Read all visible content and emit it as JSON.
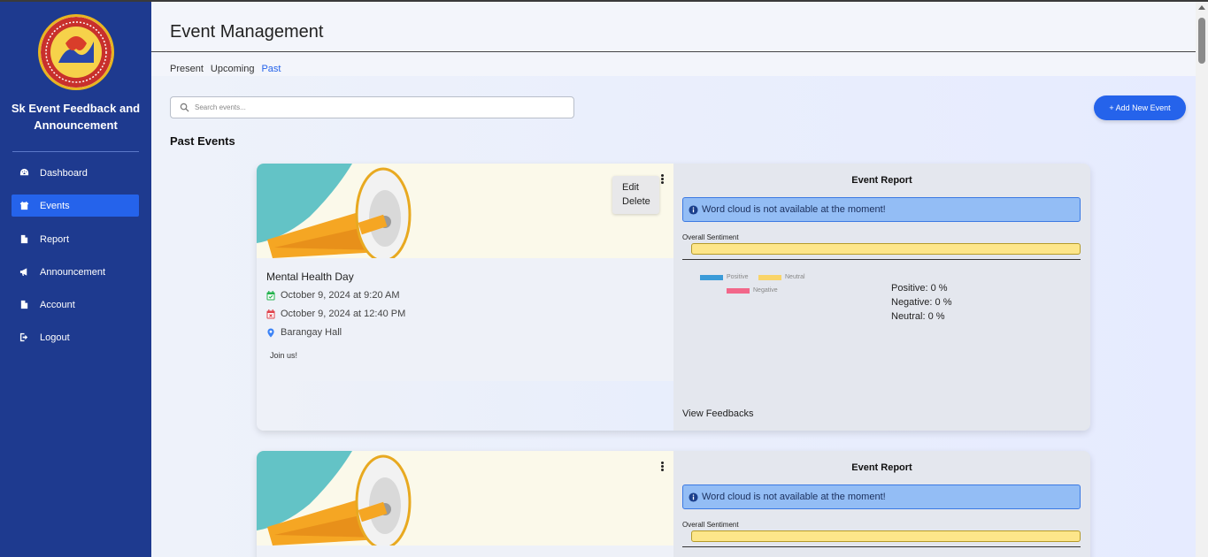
{
  "app": {
    "title": "Sk Event Feedback and Announcement"
  },
  "sidebar": {
    "items": [
      {
        "label": "Dashboard",
        "icon": "dashboard-icon"
      },
      {
        "label": "Events",
        "icon": "calendar-icon",
        "active": true
      },
      {
        "label": "Report",
        "icon": "file-icon"
      },
      {
        "label": "Announcement",
        "icon": "megaphone-icon"
      },
      {
        "label": "Account",
        "icon": "file-icon"
      },
      {
        "label": "Logout",
        "icon": "logout-icon"
      }
    ]
  },
  "header": {
    "title": "Event Management",
    "tabs": [
      {
        "label": "Present"
      },
      {
        "label": "Upcoming"
      },
      {
        "label": "Past",
        "active": true
      }
    ]
  },
  "search": {
    "placeholder": "Search events...",
    "value": ""
  },
  "add_button": {
    "label": "+ Add New Event"
  },
  "section": {
    "title": "Past Events"
  },
  "colors": {
    "sidebar": "#1e3a8f",
    "accent": "#2563eb",
    "positive": "#3b9bd8",
    "neutral": "#f9d469",
    "negative": "#f2678a"
  },
  "events": [
    {
      "name": "Mental Health Day",
      "start": "October 9, 2024 at 9:20 AM",
      "end": "October 9, 2024 at 12:40 PM",
      "location": "Barangay Hall",
      "description": "Join us!",
      "menu": {
        "edit": "Edit",
        "delete": "Delete"
      },
      "report": {
        "title": "Event Report",
        "info": "Word cloud is not available at the moment!",
        "sentiment_label": "Overall Sentiment",
        "legend": {
          "positive": "Positive",
          "neutral": "Neutral",
          "negative": "Negative"
        },
        "stats": {
          "positive": "Positive: 0 %",
          "negative": "Negative: 0 %",
          "neutral": "Neutral: 0 %"
        },
        "view_feedbacks": "View Feedbacks"
      }
    },
    {
      "report": {
        "title": "Event Report",
        "info": "Word cloud is not available at the moment!",
        "sentiment_label": "Overall Sentiment"
      }
    }
  ]
}
